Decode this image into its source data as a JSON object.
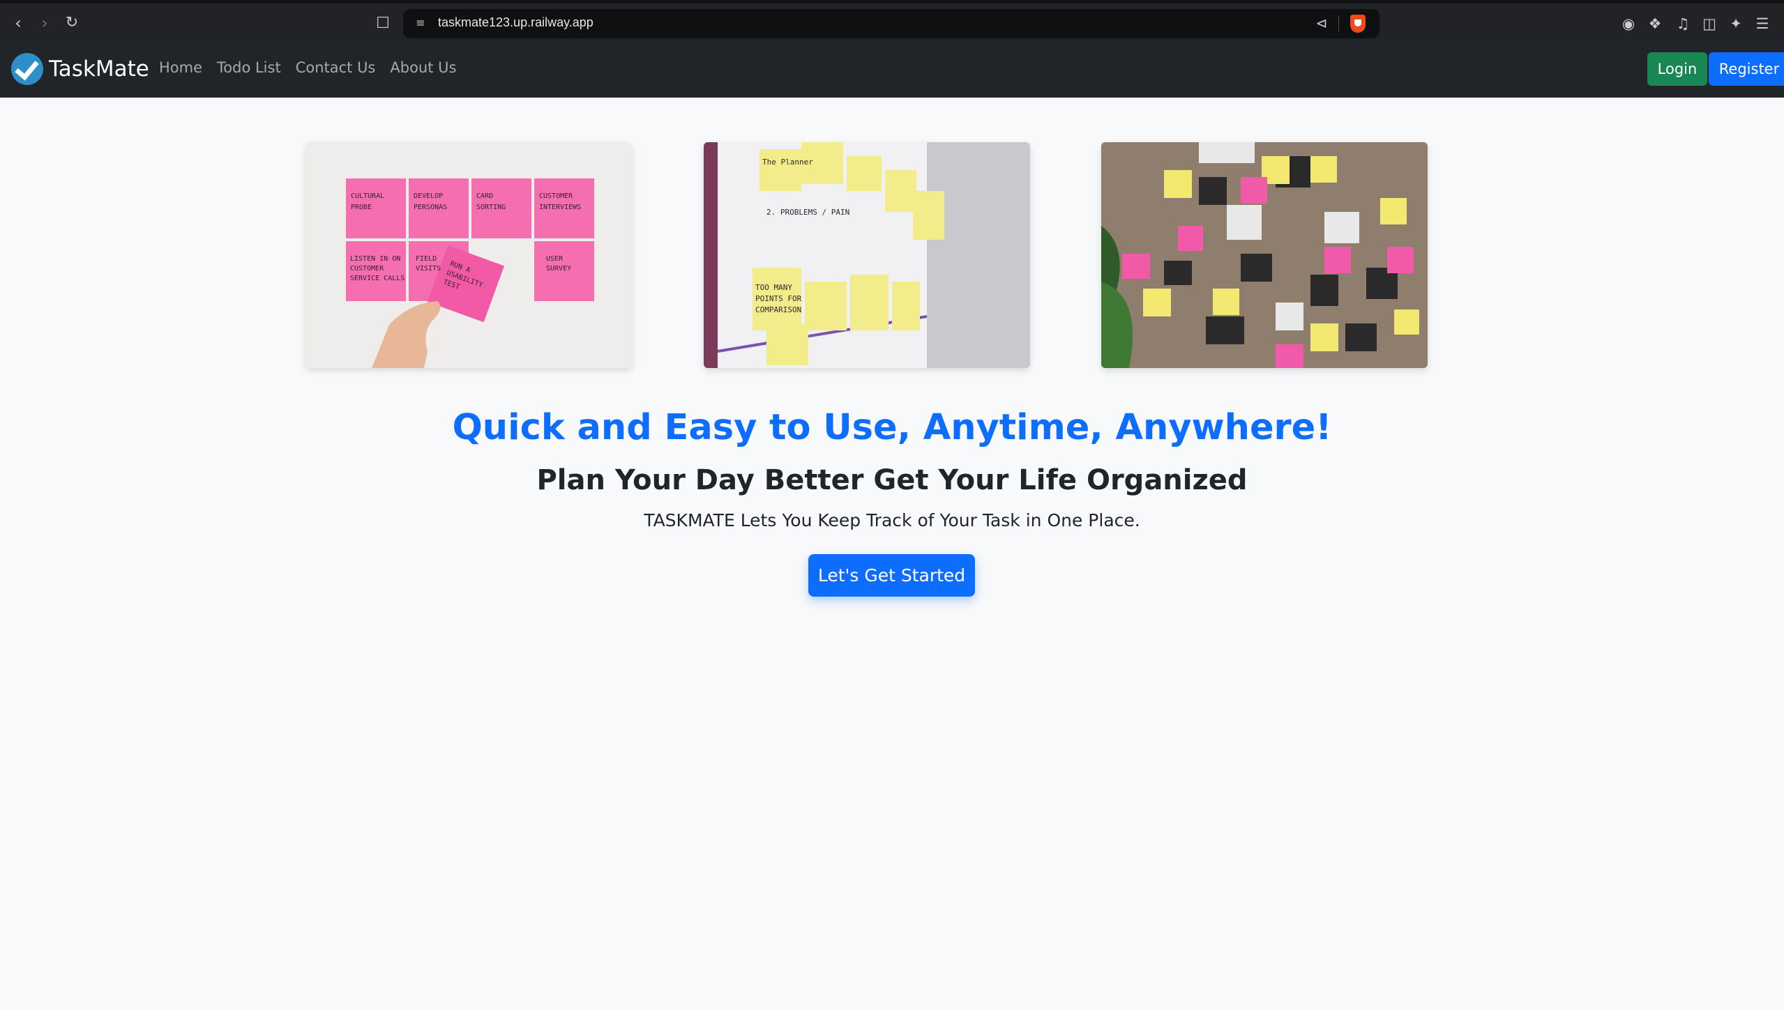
{
  "browser": {
    "url": "taskmate123.up.railway.app",
    "icons": [
      "back-icon",
      "forward-icon",
      "reload-icon",
      "bookmark-icon",
      "site-settings-icon",
      "share-icon",
      "brave-shield-icon",
      "extension-icon",
      "puzzle-icon",
      "music-icon",
      "sidebar-icon",
      "leo-icon",
      "menu-icon"
    ]
  },
  "navbar": {
    "brand": "TaskMate",
    "links": [
      "Home",
      "Todo List",
      "Contact Us",
      "About Us"
    ],
    "login_label": "Login",
    "register_label": "Register"
  },
  "gallery": {
    "images": [
      {
        "name": "pink-sticky-notes-image",
        "notes": [
          "CULTURAL PROBE",
          "DEVELOP PERSONAS",
          "CARD SORTING",
          "CUSTOMER INTERVIEWS",
          "LISTEN IN ON CUSTOMER SERVICE CALLS",
          "FIELD VISITS",
          "RUN A USABILITY TEST",
          "USER SURVEY"
        ]
      },
      {
        "name": "whiteboard-sticky-notes-image"
      },
      {
        "name": "photo-wall-sticky-notes-image"
      }
    ]
  },
  "hero": {
    "title": "Quick and Easy to Use, Anytime, Anywhere!",
    "subtitle": "Plan Your Day Better Get Your Life Organized",
    "lead": "TASKMATE Lets You Keep Track of Your Task in One Place.",
    "cta_label": "Let's Get Started"
  },
  "colors": {
    "primary": "#0d6efd",
    "success": "#198754",
    "navbar": "#212529",
    "page_bg": "#f8f9fa"
  }
}
